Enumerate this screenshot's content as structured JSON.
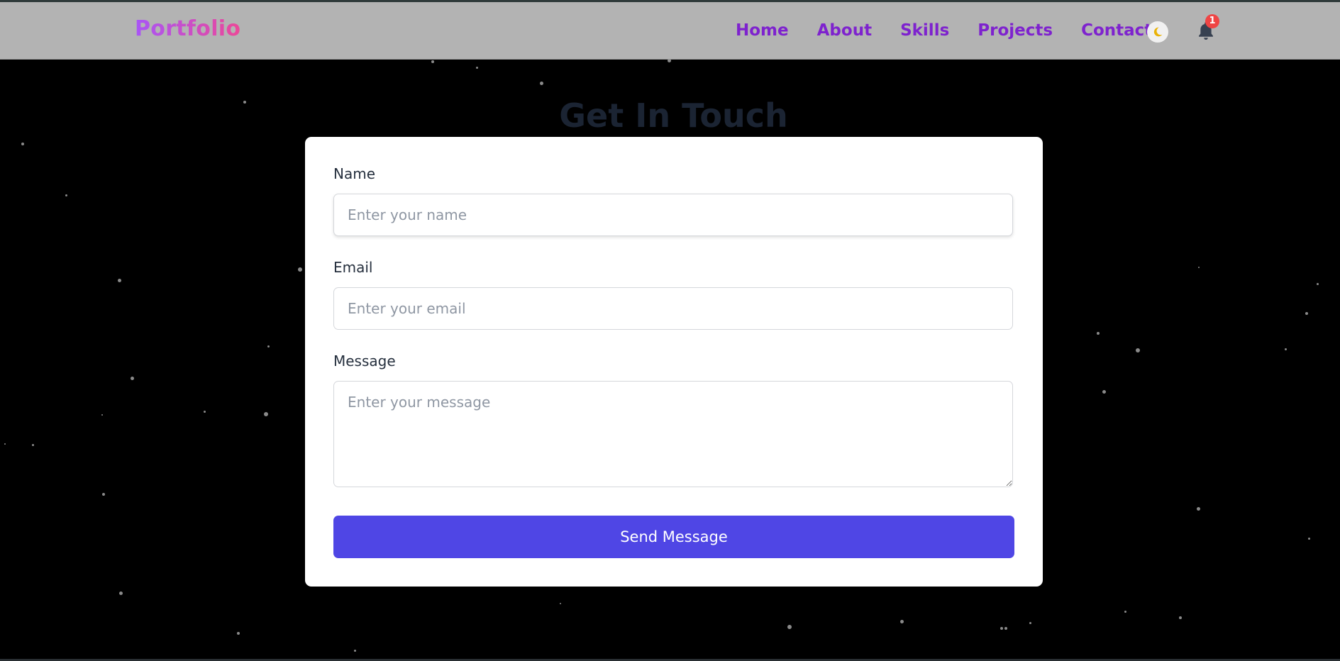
{
  "nav": {
    "brand": "Portfolio",
    "links": [
      "Home",
      "About",
      "Skills",
      "Projects",
      "Contact"
    ],
    "theme_toggle_icon": "moon-icon",
    "notification_icon": "bell-icon",
    "notification_count": "1"
  },
  "section": {
    "title": "Get In Touch"
  },
  "form": {
    "name_label": "Name",
    "name_placeholder": "Enter your name",
    "email_label": "Email",
    "email_placeholder": "Enter your email",
    "message_label": "Message",
    "message_placeholder": "Enter your message",
    "submit_label": "Send Message"
  },
  "colors": {
    "nav_background": "#b3b3b3",
    "nav_link": "#7e22ce",
    "brand_gradient": [
      "#a855f7",
      "#ec4899"
    ],
    "page_background": "#000000",
    "card_background": "#ffffff",
    "button": "#4f46e5",
    "badge": "#ef4444"
  }
}
